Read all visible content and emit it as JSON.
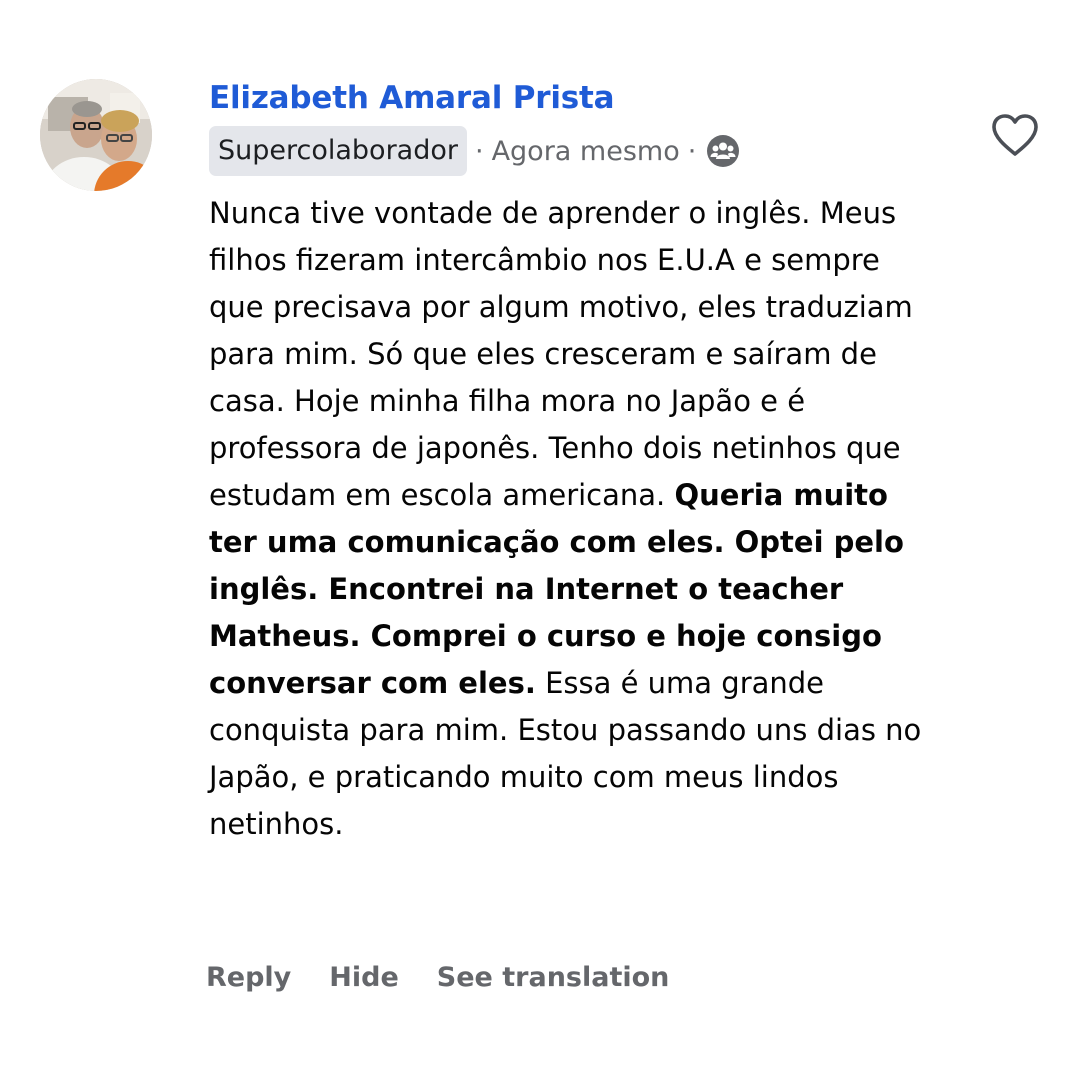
{
  "comment": {
    "author": "Elizabeth Amaral Prista",
    "badge": "Supercolaborador",
    "separator": "·",
    "timestamp": "Agora mesmo",
    "audience_icon": "group-icon",
    "like_icon": "heart-outline-icon",
    "body": {
      "intro": "Nunca tive vontade de aprender o inglês. Meus filhos fizeram intercâmbio nos E.U.A e sempre que precisava por algum motivo, eles traduziam para mim. Só que eles cresceram e saíram de casa. Hoje minha filha mora no Japão e é professora de japonês. Tenho dois netinhos que estudam em escola americana. ",
      "emphasis": "Queria muito ter uma comunicação com eles. Optei pelo inglês. Encontrei na Internet o teacher Matheus. Comprei o curso e hoje consigo conversar com eles.",
      "outro": " Essa é uma grande conquista para mim. Estou passando uns dias no Japão, e praticando muito com meus lindos netinhos."
    },
    "actions": {
      "reply": "Reply",
      "hide": "Hide",
      "translate": "See translation"
    }
  },
  "colors": {
    "author_name": "#1f5bd6",
    "badge_bg": "#e4e6eb",
    "secondary_text": "#65676b",
    "body_text": "#050505"
  }
}
